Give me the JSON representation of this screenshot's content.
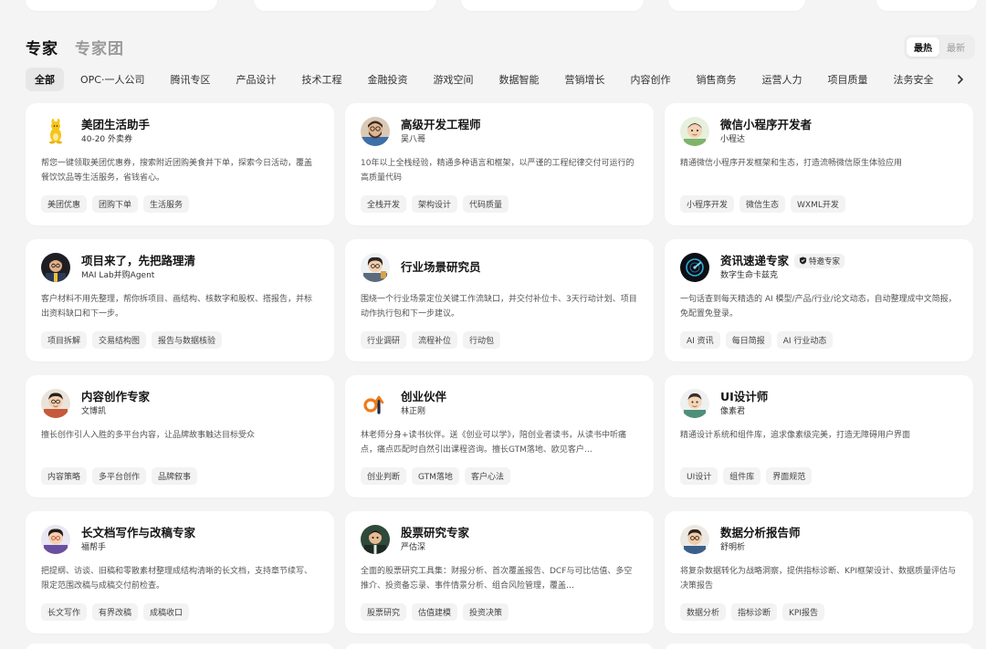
{
  "header": {
    "tab_experts": "专家",
    "tab_teams": "专家团",
    "sort_hot": "最热",
    "sort_new": "最新"
  },
  "categories": [
    "全部",
    "OPC·一人公司",
    "腾讯专区",
    "产品设计",
    "技术工程",
    "金融投资",
    "游戏空间",
    "数据智能",
    "营销增长",
    "内容创作",
    "销售商务",
    "运营人力",
    "项目质量",
    "法务安全"
  ],
  "icons": {
    "category_next": "chevron-right-icon",
    "badge": "shield-badge-icon"
  },
  "colors": {
    "page_bg": "#f4f4f5",
    "card_bg": "#ffffff",
    "tag_bg": "#f3f3f4",
    "active_category_bg": "#e7e7e8"
  },
  "cards": [
    {
      "name": "美团生活助手",
      "sub": "40-20 外卖券",
      "desc": "帮您一键领取美团优惠券，搜索附近团购美食并下单，探索今日活动，覆盖餐饮饮品等生活服务，省钱省心。",
      "tags": [
        "美团优惠",
        "团购下单",
        "生活服务"
      ],
      "avatar": "kangaroo-mascot-avatar"
    },
    {
      "name": "高级开发工程师",
      "sub": "吴八哥",
      "desc": "10年以上全栈经验，精通多种语言和框架，以严谨的工程纪律交付可运行的高质量代码",
      "tags": [
        "全栈开发",
        "架构设计",
        "代码质量"
      ],
      "avatar": "bearded-developer-avatar"
    },
    {
      "name": "微信小程序开发者",
      "sub": "小程达",
      "desc": "精通微信小程序开发框架和生态，打造流畅微信原生体验应用",
      "tags": [
        "小程序开发",
        "微信生态",
        "WXML开发"
      ],
      "avatar": "cartoon-boy-avatar"
    },
    {
      "name": "项目来了，先把路理清",
      "sub": "MAI Lab并购Agent",
      "desc": "客户材料不用先整理，帮你拆项目、画结构、核数字和股权、搭报告，并标出资料缺口和下一步。",
      "tags": [
        "项目拆解",
        "交易结构图",
        "报告与数据核验"
      ],
      "avatar": "analyst-avatar"
    },
    {
      "name": "行业场景研究员",
      "sub": "",
      "desc": "围绕一个行业场景定位关键工作流缺口，并交付补位卡、3天行动计划、项目动作执行包和下一步建议。",
      "tags": [
        "行业调研",
        "流程补位",
        "行动包"
      ],
      "avatar": "researcher-avatar"
    },
    {
      "name": "资讯速递专家",
      "sub": "数字生命卡兹克",
      "badge": "特邀专家",
      "desc": "一句话查到每天精选的 AI 模型/产品/行业/论文动态，自动整理成中文简报，免配置免登录。",
      "tags": [
        "AI 资讯",
        "每日简报",
        "AI 行业动态"
      ],
      "avatar": "radar-logo-avatar"
    },
    {
      "name": "内容创作专家",
      "sub": "文博凯",
      "desc": "擅长创作引人入胜的多平台内容，让品牌故事触达目标受众",
      "tags": [
        "内容策略",
        "多平台创作",
        "品牌叙事"
      ],
      "avatar": "writer-avatar"
    },
    {
      "name": "创业伙伴",
      "sub": "林正刚",
      "desc": "林老师分身+读书伙伴。送《创业可以学》，陪创业者读书，从读书中听痛点，痛点匹配时自然引出课程咨询。擅长GTM落地、欧见客户…",
      "tags": [
        "创业判断",
        "GTM落地",
        "客户心法"
      ],
      "avatar": "orange-logo-avatar"
    },
    {
      "name": "UI设计师",
      "sub": "像素君",
      "desc": "精通设计系统和组件库，追求像素级完美，打造无障碍用户界面",
      "tags": [
        "UI设计",
        "组件库",
        "界面规范"
      ],
      "avatar": "designer-avatar"
    },
    {
      "name": "长文档写作与改稿专家",
      "sub": "福帮手",
      "desc": "把提纲、访谈、旧稿和零散素材整理成结构清晰的长文档，支持章节续写、限定范围改稿与成稿交付前检查。",
      "tags": [
        "长文写作",
        "有界改稿",
        "成稿收口"
      ],
      "avatar": "editor-avatar"
    },
    {
      "name": "股票研究专家",
      "sub": "严估深",
      "desc": "全面的股票研究工具集：财报分析、首次覆盖报告、DCF与可比估值、多空推介、投资备忘录、事件情景分析、组合风险管理，覆盖…",
      "tags": [
        "股票研究",
        "估值建模",
        "投资决策"
      ],
      "avatar": "stock-analyst-avatar"
    },
    {
      "name": "数据分析报告师",
      "sub": "舒明析",
      "desc": "将复杂数据转化为战略洞察，提供指标诊断、KPI框架设计、数据质量评估与决策报告",
      "tags": [
        "数据分析",
        "指标诊断",
        "KPI报告"
      ],
      "avatar": "data-analyst-avatar"
    }
  ]
}
